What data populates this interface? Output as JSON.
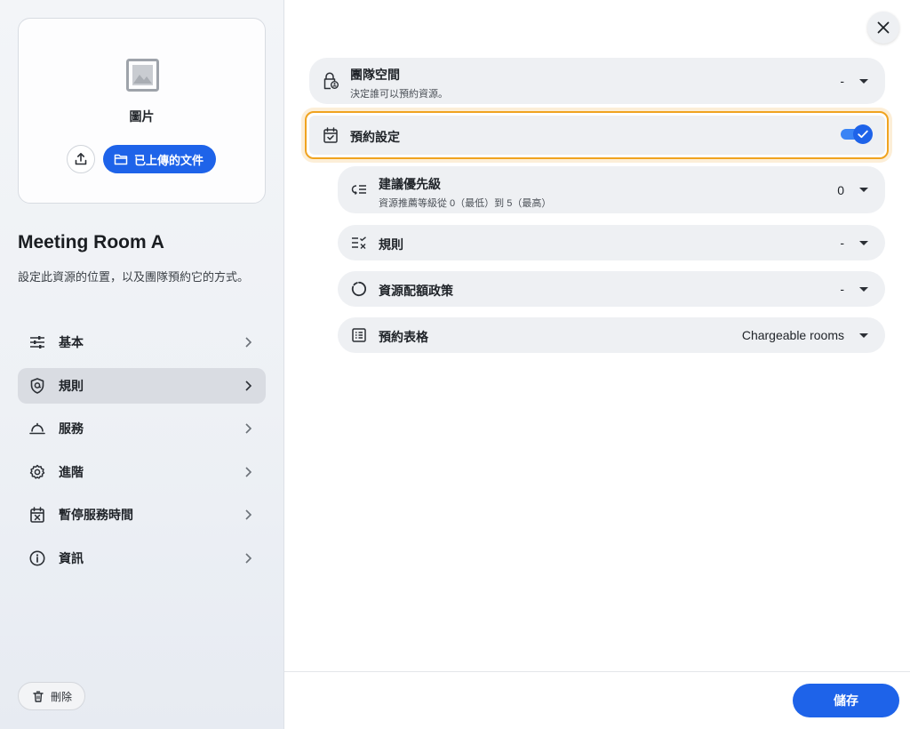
{
  "sidebar": {
    "image_card": {
      "label": "圖片",
      "uploaded_docs_label": "已上傳的文件"
    },
    "resource": {
      "title": "Meeting Room A",
      "description": "設定此資源的位置，以及團隊預約它的方式。"
    },
    "nav_items": [
      {
        "label": "基本",
        "icon": "sliders-icon"
      },
      {
        "label": "規則",
        "icon": "shield-icon"
      },
      {
        "label": "服務",
        "icon": "service-bell-icon"
      },
      {
        "label": "進階",
        "icon": "gear-icon"
      },
      {
        "label": "暫停服務時間",
        "icon": "calendar-x-icon"
      },
      {
        "label": "資訊",
        "icon": "info-icon"
      }
    ],
    "active_nav_index": 1,
    "delete_label": "刪除"
  },
  "main": {
    "team_space": {
      "title": "團隊空間",
      "subtitle": "決定誰可以預約資源。",
      "value": "-"
    },
    "booking_settings": {
      "title": "預約設定",
      "enabled": true
    },
    "suggested_priority": {
      "title": "建議優先級",
      "subtitle": "資源推薦等級從 0（最低）到 5（最高）",
      "value": "0"
    },
    "rules": {
      "title": "規則",
      "value": "-"
    },
    "quota_policy": {
      "title": "資源配額政策",
      "value": "-"
    },
    "booking_form": {
      "title": "預約表格",
      "value": "Chargeable rooms"
    },
    "save_label": "儲存"
  },
  "colors": {
    "accent": "#1e63e9",
    "highlight": "#f0a31f",
    "row_bg": "#eef0f3",
    "active_nav_bg": "#d9dce2"
  }
}
